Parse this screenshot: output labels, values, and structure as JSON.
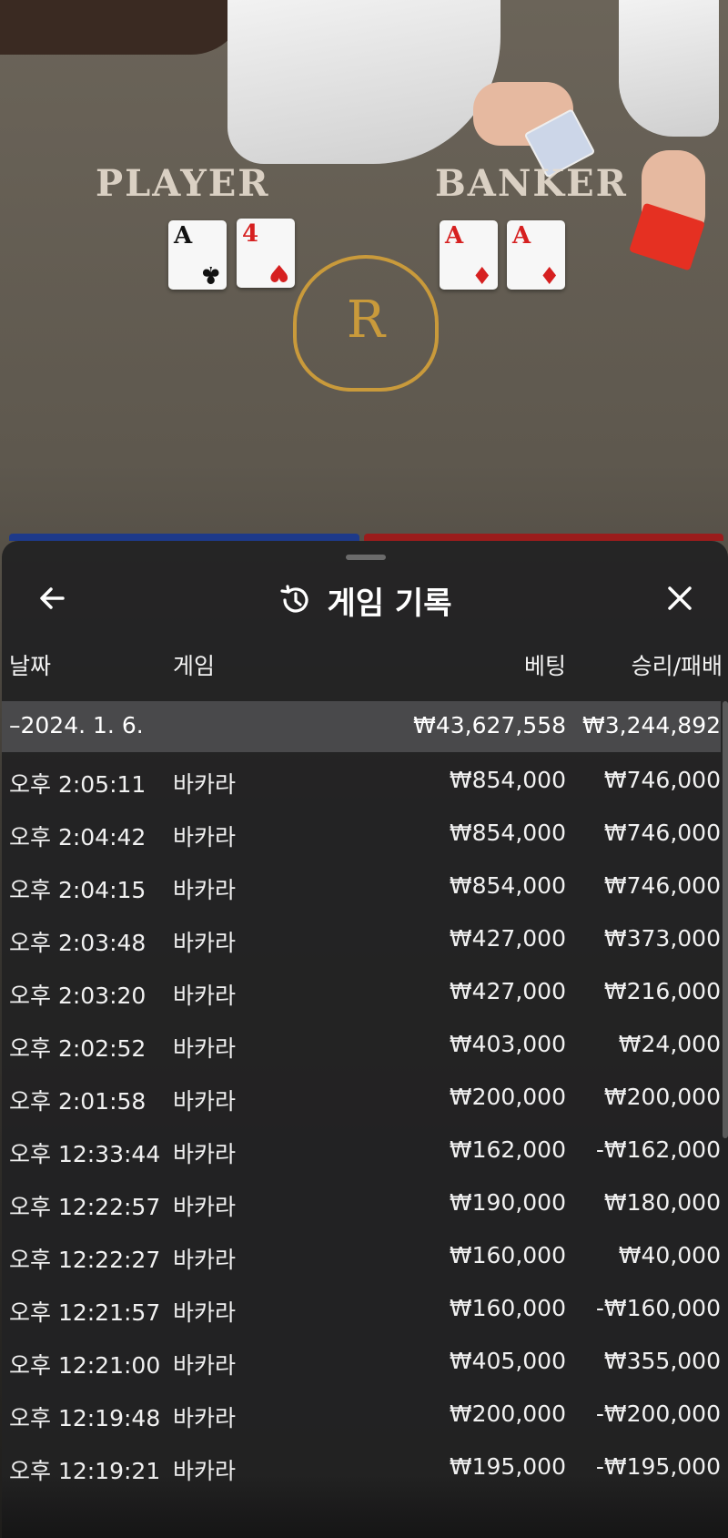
{
  "table": {
    "player_label": "PLAYER",
    "banker_label": "BANKER",
    "emblem_letter": "R",
    "player_cards": [
      {
        "rank": "A",
        "suit": "♣",
        "color": "black"
      },
      {
        "rank": "4",
        "suit": "♥",
        "color": "red"
      }
    ],
    "banker_cards": [
      {
        "rank": "A",
        "suit": "♦",
        "color": "red"
      },
      {
        "rank": "A",
        "suit": "♦",
        "color": "red"
      }
    ]
  },
  "sheet": {
    "title": "게임 기록",
    "back_icon": "arrow-left-icon",
    "history_icon": "history-clock-icon",
    "close_icon": "close-icon"
  },
  "columns": {
    "date": "날짜",
    "game": "게임",
    "bet": "베팅",
    "win_loss": "승리/패배"
  },
  "summary": {
    "date": "–2024. 1. 6.",
    "bet": "₩43,627,558",
    "win_loss": "₩3,244,892"
  },
  "rows": [
    {
      "time": "오후 2:05:11",
      "game": "바카라",
      "bet": "₩854,000",
      "result": "₩746,000"
    },
    {
      "time": "오후 2:04:42",
      "game": "바카라",
      "bet": "₩854,000",
      "result": "₩746,000"
    },
    {
      "time": "오후 2:04:15",
      "game": "바카라",
      "bet": "₩854,000",
      "result": "₩746,000"
    },
    {
      "time": "오후 2:03:48",
      "game": "바카라",
      "bet": "₩427,000",
      "result": "₩373,000"
    },
    {
      "time": "오후 2:03:20",
      "game": "바카라",
      "bet": "₩427,000",
      "result": "₩216,000"
    },
    {
      "time": "오후 2:02:52",
      "game": "바카라",
      "bet": "₩403,000",
      "result": "₩24,000"
    },
    {
      "time": "오후 2:01:58",
      "game": "바카라",
      "bet": "₩200,000",
      "result": "₩200,000"
    },
    {
      "time": "오후 12:33:44",
      "game": "바카라",
      "bet": "₩162,000",
      "result": "-₩162,000"
    },
    {
      "time": "오후 12:22:57",
      "game": "바카라",
      "bet": "₩190,000",
      "result": "₩180,000"
    },
    {
      "time": "오후 12:22:27",
      "game": "바카라",
      "bet": "₩160,000",
      "result": "₩40,000"
    },
    {
      "time": "오후 12:21:57",
      "game": "바카라",
      "bet": "₩160,000",
      "result": "-₩160,000"
    },
    {
      "time": "오후 12:21:00",
      "game": "바카라",
      "bet": "₩405,000",
      "result": "₩355,000"
    },
    {
      "time": "오후 12:19:48",
      "game": "바카라",
      "bet": "₩200,000",
      "result": "-₩200,000"
    },
    {
      "time": "오후 12:19:21",
      "game": "바카라",
      "bet": "₩195,000",
      "result": "-₩195,000"
    }
  ]
}
